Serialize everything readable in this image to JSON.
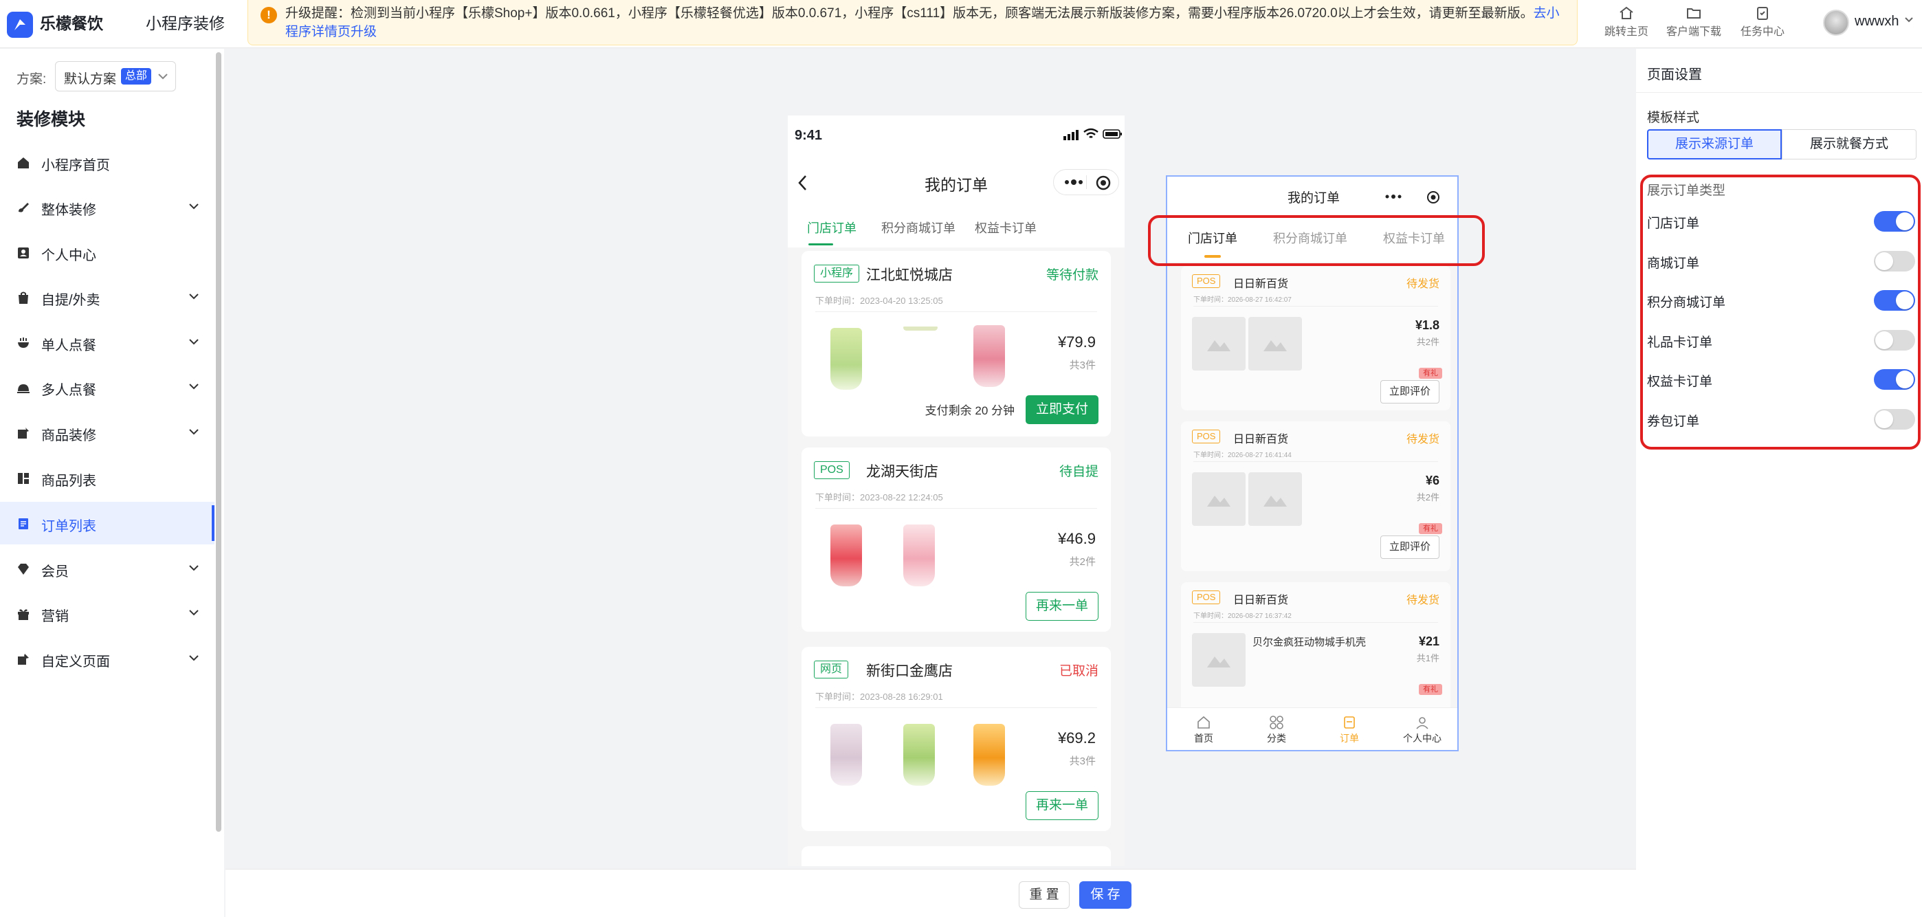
{
  "header": {
    "brand": "乐檬餐饮",
    "page": "小程序装修",
    "notice_text": "升级提醒：检测到当前小程序【乐檬Shop+】版本0.0.661，小程序【乐檬轻餐优选】版本0.0.671，小程序【cs111】版本无，顾客端无法展示新版装修方案，需要小程序版本26.0720.0以上才会生效，请更新至最新版。",
    "notice_link": "去小程序详情页升级",
    "actions": [
      {
        "label": "跳转主页",
        "icon": "home-icon"
      },
      {
        "label": "客户端下载",
        "icon": "folder-sync-icon"
      },
      {
        "label": "任务中心",
        "icon": "clipboard-icon"
      }
    ],
    "user": "wwwxh"
  },
  "sidebar": {
    "scheme_label": "方案:",
    "scheme_value": "默认方案",
    "scheme_badge": "总部",
    "modules_title": "装修模块",
    "items": [
      {
        "label": "小程序首页",
        "icon": "home-icon",
        "expandable": false
      },
      {
        "label": "整体装修",
        "icon": "brush-icon",
        "expandable": true
      },
      {
        "label": "个人中心",
        "icon": "user-card-icon",
        "expandable": false
      },
      {
        "label": "自提/外卖",
        "icon": "bag-icon",
        "expandable": true
      },
      {
        "label": "单人点餐",
        "icon": "bowl-icon",
        "expandable": true
      },
      {
        "label": "多人点餐",
        "icon": "cloche-icon",
        "expandable": true
      },
      {
        "label": "商品装修",
        "icon": "product-decor-icon",
        "expandable": true
      },
      {
        "label": "商品列表",
        "icon": "grid-list-icon",
        "expandable": false
      },
      {
        "label": "订单列表",
        "icon": "order-list-icon",
        "expandable": false,
        "active": true
      },
      {
        "label": "会员",
        "icon": "diamond-icon",
        "expandable": true
      },
      {
        "label": "营销",
        "icon": "gift-icon",
        "expandable": true
      },
      {
        "label": "自定义页面",
        "icon": "custom-page-icon",
        "expandable": true
      }
    ]
  },
  "phone1": {
    "time": "9:41",
    "title": "我的订单",
    "tabs": [
      "门店订单",
      "积分商城订单",
      "权益卡订单"
    ],
    "orders": [
      {
        "tag": "小程序",
        "store": "江北虹悦城店",
        "status": "等待付款",
        "time": "下单时间：2023-04-20 13:25:05",
        "price": "¥79.9",
        "qty": "共3件",
        "remaining": "支付剩余 20 分钟",
        "button": "立即支付"
      },
      {
        "tag": "POS",
        "store": "龙湖天街店",
        "status": "待自提",
        "time": "下单时间：2023-08-22 12:24:05",
        "price": "¥46.9",
        "qty": "共2件",
        "button": "再来一单"
      },
      {
        "tag": "网页",
        "store": "新街口金鹰店",
        "status": "已取消",
        "time": "下单时间：2023-08-28 16:29:01",
        "price": "¥69.2",
        "qty": "共3件",
        "button": "再来一单"
      }
    ]
  },
  "phone2": {
    "title": "我的订单",
    "tabs": [
      "门店订单",
      "积分商城订单",
      "权益卡订单"
    ],
    "orders": [
      {
        "tag": "POS",
        "store": "日日新百货",
        "status": "待发货",
        "time": "下单时间：2026-08-27 16:42:07",
        "price": "¥1.8",
        "qty": "共2件",
        "gift": "有礼",
        "button": "立即评价"
      },
      {
        "tag": "POS",
        "store": "日日新百货",
        "status": "待发货",
        "time": "下单时间：2026-08-27 16:41:44",
        "price": "¥6",
        "qty": "共2件",
        "gift": "有礼",
        "button": "立即评价"
      },
      {
        "tag": "POS",
        "store": "日日新百货",
        "status": "待发货",
        "time": "下单时间：2026-08-27 16:37:42",
        "product": "贝尔金疯狂动物城手机壳",
        "price": "¥21",
        "qty": "共1件",
        "gift": "有礼"
      }
    ],
    "tabbar": [
      "首页",
      "分类",
      "订单",
      "个人中心"
    ]
  },
  "bottom": {
    "reset": "重 置",
    "save": "保 存"
  },
  "right_panel": {
    "title": "页面设置",
    "template_label": "模板样式",
    "template_options": [
      "展示来源订单",
      "展示就餐方式"
    ],
    "types_label": "展示订单类型",
    "types": [
      {
        "label": "门店订单",
        "on": true
      },
      {
        "label": "商城订单",
        "on": false
      },
      {
        "label": "积分商城订单",
        "on": true
      },
      {
        "label": "礼品卡订单",
        "on": false
      },
      {
        "label": "权益卡订单",
        "on": true
      },
      {
        "label": "券包订单",
        "on": false
      }
    ]
  },
  "colors": {
    "accent": "#2f5ff5",
    "green": "#19a55c",
    "orange": "#f5a623",
    "highlight": "#e02020"
  }
}
